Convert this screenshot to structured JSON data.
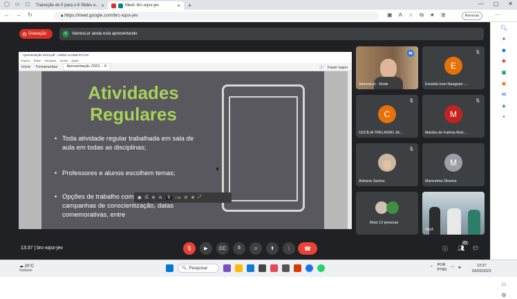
{
  "browser": {
    "tabs": [
      {
        "title": "Transição do 5 para o 6 Slides e..."
      },
      {
        "title": "Meet: brc-xqsx-jev"
      }
    ],
    "url": "https://meet.google.com/brc-xqsx-jev",
    "renew_label": "Renovar"
  },
  "meet": {
    "recording_label": "Gravação",
    "presenter_initial": "V",
    "presenting_text": "VamosLer ainda está apresentando",
    "meeting_time": "13:37",
    "meeting_code": "brc-xqsx-jev",
    "participant_count": "21"
  },
  "acrobat": {
    "title": "Apresentação 2023.pdf - Adobe Acrobat Pro DC",
    "menu": [
      "Arquivo",
      "Editar",
      "Visualizar",
      "Janela",
      "Ajuda"
    ],
    "tabs": [
      "Início",
      "Ferramentas",
      "Apresentação 2023..."
    ],
    "signin": "Fazer logon",
    "page_current": "9",
    "page_total": "/ 16"
  },
  "slide": {
    "title_line1": "Atividades",
    "title_line2": "Regulares",
    "bullet1": "Toda atividade regular trabalhada em sala de aula em todas as disciplinas;",
    "bullet2": "Professores e alunos escolhem temas;",
    "bullet3": "Opções de trabalho com temáticas como campanhas de conscientização, datas comemorativas, entre"
  },
  "participants": [
    {
      "name": "VamosLer - Rede"
    },
    {
      "initial": "E",
      "name": "Emelda Ione Naegeler ...",
      "color": "#e8710a"
    },
    {
      "initial": "C",
      "name": "CECÍLIA TRELINSKI JA...",
      "color": "#e8710a"
    },
    {
      "initial": "M",
      "name": "Marilza de Fatima Rod...",
      "color": "#c5221f"
    },
    {
      "name": "Adriana Santos"
    },
    {
      "initial": "M",
      "name": "Maricelma Oliveira",
      "color": "#9aa0a6"
    },
    {
      "name": "Mais 13 pessoas"
    },
    {
      "name": "Você"
    }
  ],
  "taskbar": {
    "temp": "20°C",
    "weather": "Nublado",
    "search": "Pesquisar",
    "lang1": "POR",
    "lang2": "PTB2",
    "time": "13:37",
    "date": "03/02/2023"
  }
}
